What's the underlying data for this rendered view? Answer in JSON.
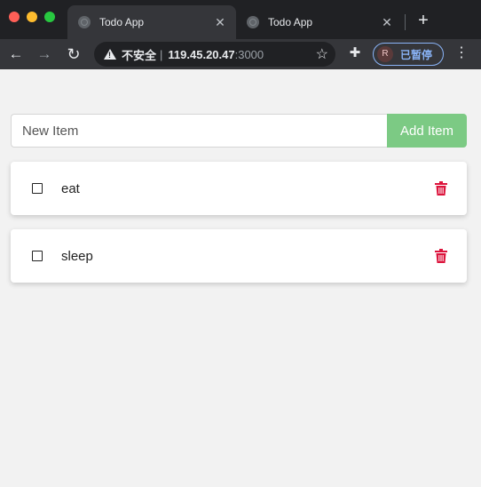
{
  "browser": {
    "tabs": [
      {
        "title": "Todo App",
        "active": true
      },
      {
        "title": "Todo App",
        "active": false
      }
    ],
    "address_bar": {
      "security_label": "不安全",
      "separator": "|",
      "host": "119.45.20.47",
      "port": ":3000"
    },
    "profile": {
      "initial": "R",
      "status": "已暂停"
    }
  },
  "todo_app": {
    "new_item_placeholder": "New Item",
    "add_button_label": "Add Item",
    "items": [
      {
        "text": "eat",
        "completed": false
      },
      {
        "text": "sleep",
        "completed": false
      }
    ]
  },
  "colors": {
    "accent_green": "#7cca84",
    "delete_red": "#dc143c",
    "page_bg": "#f2f2f2"
  }
}
